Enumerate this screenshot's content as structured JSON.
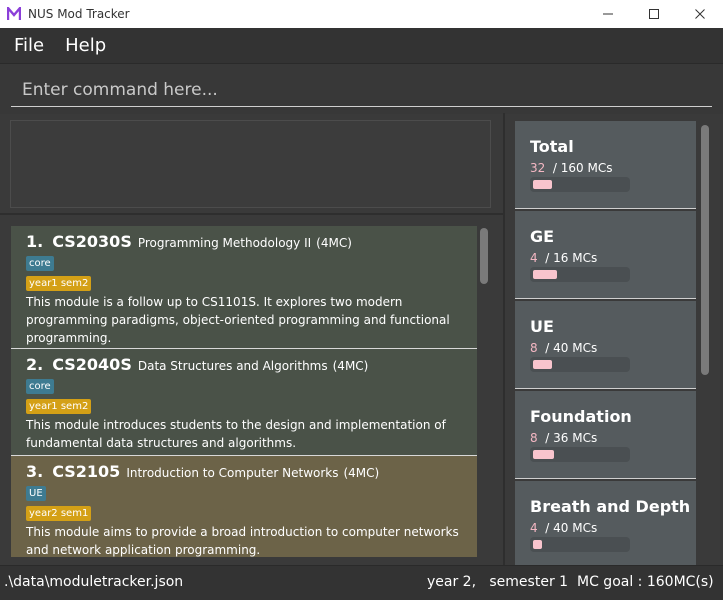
{
  "window": {
    "title": "NUS Mod Tracker",
    "controls": [
      "minimize-icon",
      "maximize-icon",
      "close-icon"
    ]
  },
  "menu": {
    "file": "File",
    "help": "Help"
  },
  "command": {
    "placeholder": "Enter command here...",
    "value": ""
  },
  "modules": [
    {
      "index": "1.",
      "code": "CS2030S",
      "title": "Programming Methodology II",
      "mc": "(4MC)",
      "type_tag": "core",
      "sem_tag": "year1 sem2",
      "description": "This module is a follow up to CS1101S. It explores two modern programming paradigms, object-oriented programming and functional programming."
    },
    {
      "index": "2.",
      "code": "CS2040S",
      "title": "Data Structures and Algorithms",
      "mc": "(4MC)",
      "type_tag": "core",
      "sem_tag": "year1 sem2",
      "description": "This module introduces students to the design and implementation of fundamental data structures and algorithms."
    },
    {
      "index": "3.",
      "code": "CS2105",
      "title": "Introduction to Computer Networks",
      "mc": "(4MC)",
      "type_tag": "UE",
      "sem_tag": "year2 sem1",
      "description": "This module aims to provide a broad introduction to computer networks and network application programming."
    }
  ],
  "requirements": [
    {
      "name": "Total",
      "current": "32",
      "total": "/ 160 MCs",
      "progress": 0.2
    },
    {
      "name": "GE",
      "current": "4",
      "total": "/ 16 MCs",
      "progress": 0.25
    },
    {
      "name": "UE",
      "current": "8",
      "total": "/ 40 MCs",
      "progress": 0.2
    },
    {
      "name": "Foundation",
      "current": "8",
      "total": "/ 36 MCs",
      "progress": 0.22
    },
    {
      "name": "Breath and Depth",
      "current": "4",
      "total": "/ 40 MCs",
      "progress": 0.1
    }
  ],
  "status": {
    "file_path": ".\\data\\moduletracker.json",
    "year_sem": "year 2,   semester 1",
    "goal": "MC goal : 160MC(s)"
  },
  "colors": {
    "accent_logo": "#8b3fd9",
    "card_green": "#4a5248",
    "card_brown": "#6c6348",
    "tag_type": "#3e7b91",
    "tag_sem": "#d4a016",
    "progress_fill": "#f8c4cd"
  }
}
